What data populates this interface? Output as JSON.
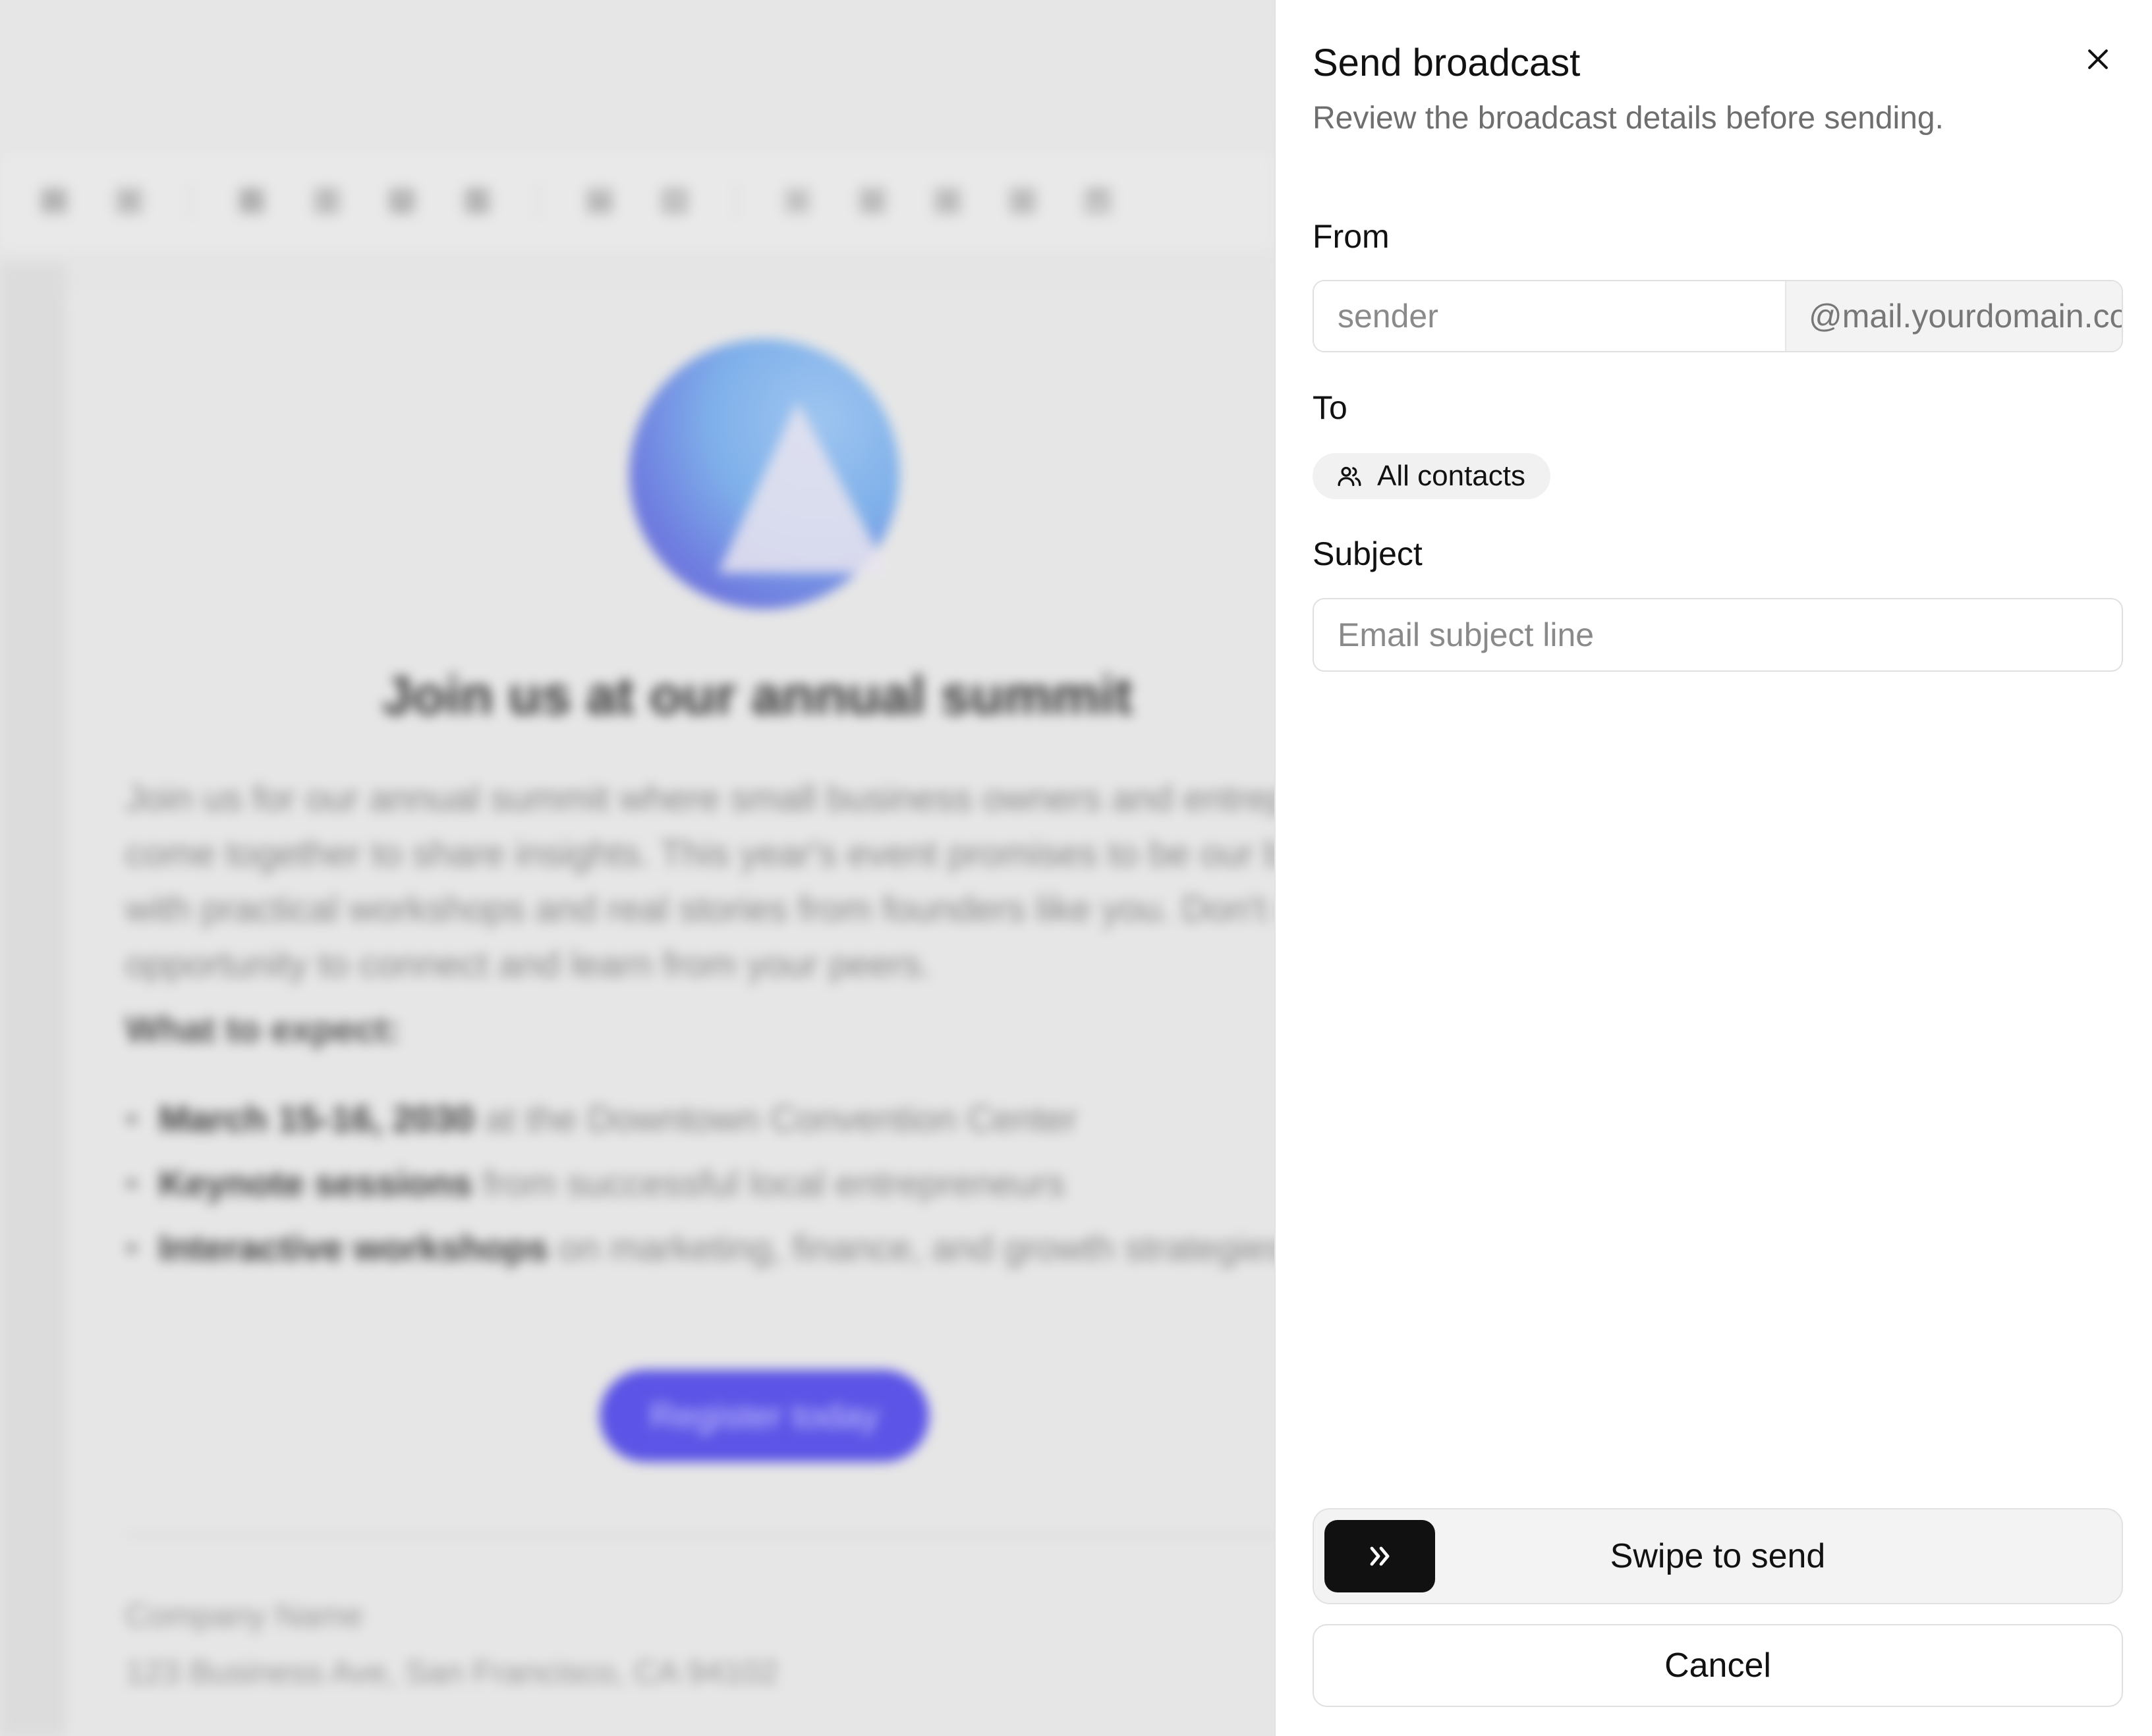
{
  "dialog": {
    "title": "Send broadcast",
    "subtitle": "Review the broadcast details before sending.",
    "close_icon": "close-icon",
    "from": {
      "label": "From",
      "placeholder": "sender",
      "value": "",
      "domain_suffix": "@mail.yourdomain.com"
    },
    "to": {
      "label": "To",
      "chip_label": "All contacts",
      "chip_icon": "users-icon"
    },
    "subject": {
      "label": "Subject",
      "placeholder": "Email subject line",
      "value": ""
    },
    "swipe": {
      "label": "Swipe to send",
      "handle_icon": "chevrons-right-icon"
    },
    "cancel_label": "Cancel"
  },
  "editor_preview": {
    "toolbar_icons": [
      "heading-icon",
      "plus-icon",
      "bold-icon",
      "italic-icon",
      "underline-icon",
      "strikethrough-icon",
      "link-icon",
      "image-icon",
      "align-left-icon",
      "align-center-icon",
      "align-right-icon",
      "align-justify-icon",
      "quote-icon"
    ],
    "email_title": "Join us at our annual summit",
    "paragraph": "Join us for our annual summit where small business owners and entrepreneurs come together to share insights. This year's event promises to be our biggest yet with practical workshops and real stories from founders like you. Don't miss this opportunity to connect and learn from your peers.",
    "section_heading": "What to expect:",
    "list": [
      {
        "bold": "March 15-16, 2030",
        "rest": " at the Downtown Convention Center"
      },
      {
        "bold": "Keynote sessions",
        "rest": " from successful local entrepreneurs"
      },
      {
        "bold": "Interactive workshops",
        "rest": " on marketing, finance, and growth strategies"
      }
    ],
    "cta_label": "Register today",
    "footer_company": "Company Name",
    "footer_address": "123 Business Ave, San Francisco, CA 94102"
  },
  "colors": {
    "accent_purple": "#5b54e6",
    "handle_dark": "#111111",
    "panel_bg": "#ffffff"
  }
}
